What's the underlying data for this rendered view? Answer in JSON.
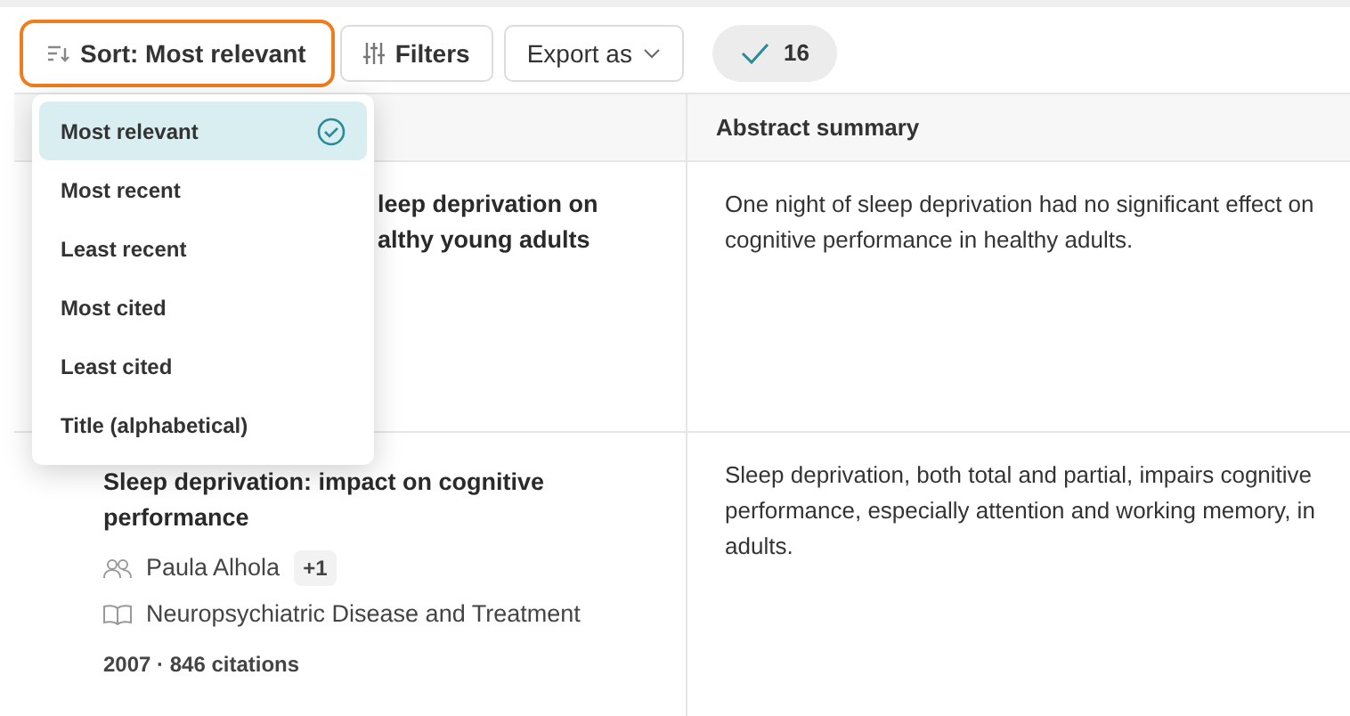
{
  "toolbar": {
    "sort_button": {
      "label": "Sort: Most relevant",
      "highlighted": true
    },
    "filters_button": "Filters",
    "export_button": "Export as",
    "selected_count": "16"
  },
  "sort_menu": {
    "items": [
      {
        "label": "Most relevant",
        "selected": true
      },
      {
        "label": "Most recent",
        "selected": false
      },
      {
        "label": "Least recent",
        "selected": false
      },
      {
        "label": "Most cited",
        "selected": false
      },
      {
        "label": "Least cited",
        "selected": false
      },
      {
        "label": "Title (alphabetical)",
        "selected": false
      }
    ]
  },
  "table": {
    "columns": [
      "Abstract summary"
    ],
    "rows": [
      {
        "title_lines": [
          "leep deprivation on",
          "althy young adults"
        ],
        "title_cut_left": true,
        "summary": "One night of sleep deprivation had no significant effect on cognitive performance in healthy adults."
      },
      {
        "title_lines": [
          "Sleep deprivation: impact on cognitive",
          "performance"
        ],
        "title_cut_left": false,
        "author": "Paula Alhola",
        "more_authors": "+1",
        "journal": "Neuropsychiatric Disease and Treatment",
        "meta": "2007 · 846 citations",
        "summary": "Sleep deprivation, both total and partial, impairs cognitive performance, especially attention and working memory, in adults."
      }
    ]
  }
}
